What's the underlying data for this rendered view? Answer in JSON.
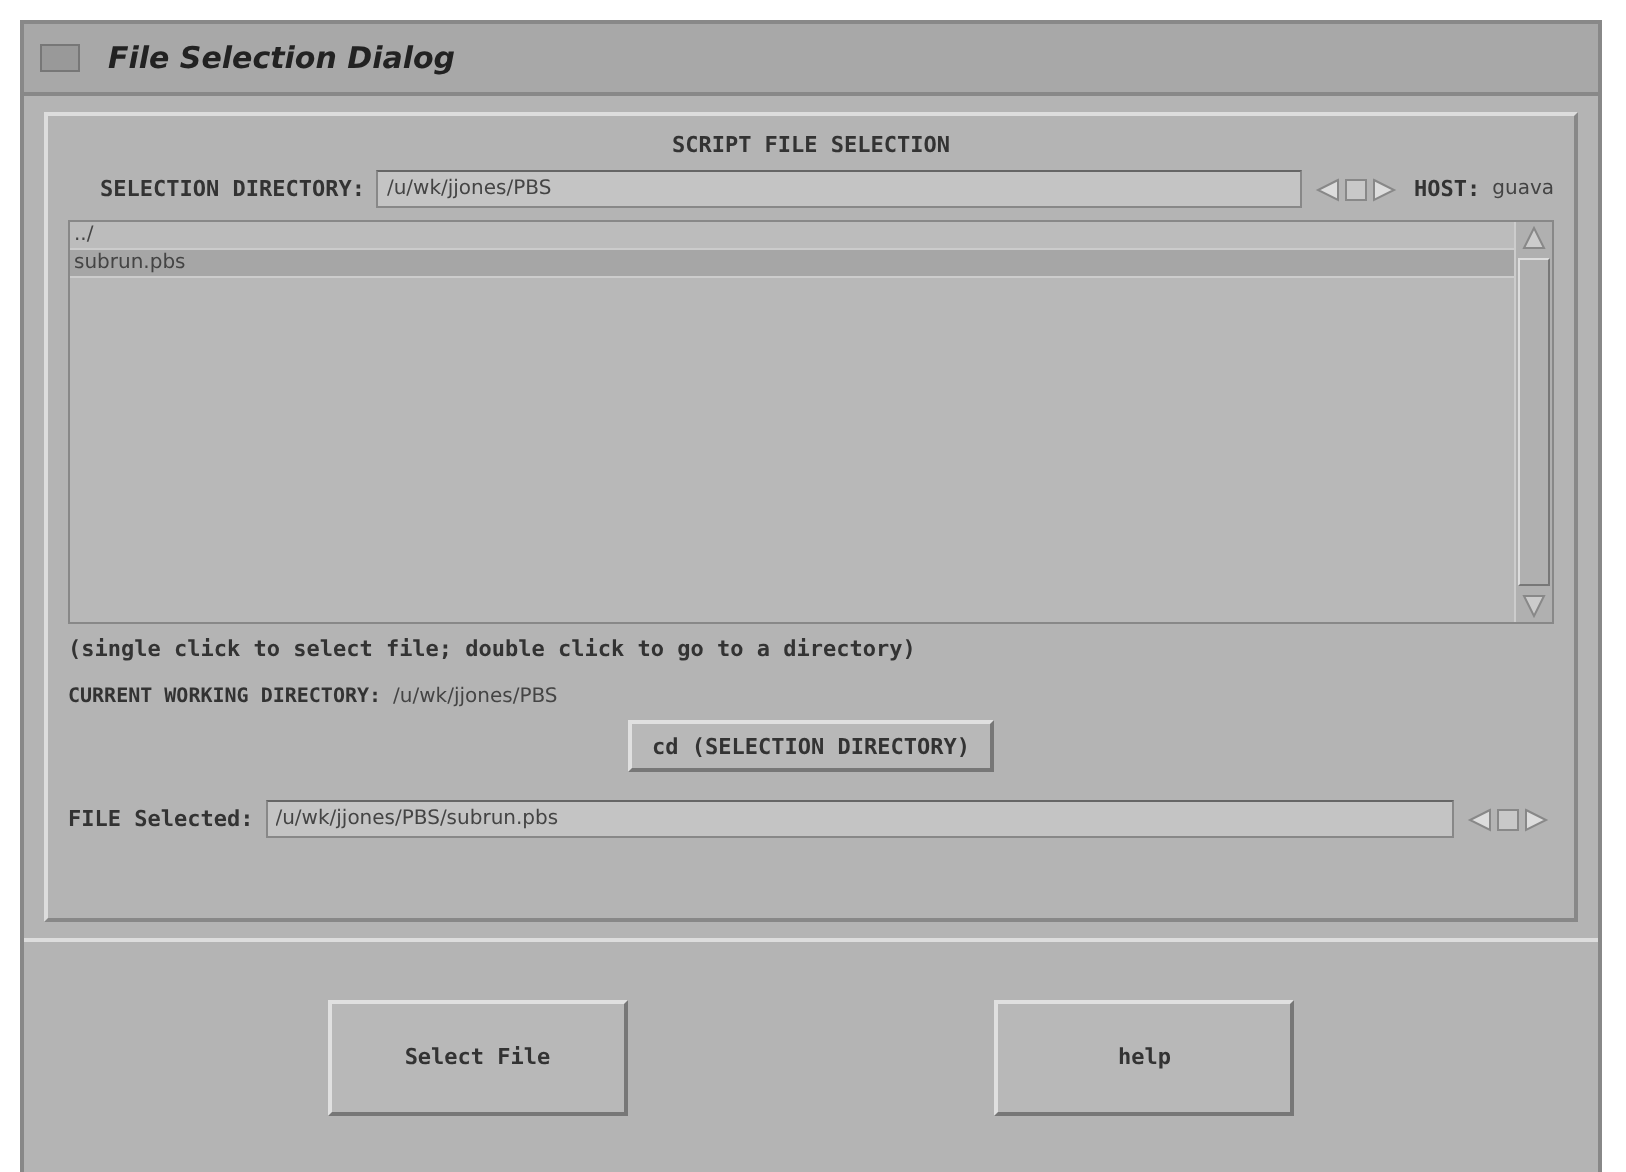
{
  "window": {
    "title": "File Selection Dialog"
  },
  "heading": "SCRIPT FILE SELECTION",
  "selection_directory": {
    "label": "SELECTION DIRECTORY:",
    "value": "/u/wk/jjones/PBS"
  },
  "host": {
    "label": "HOST:",
    "value": "guava"
  },
  "files": [
    {
      "name": "../",
      "selected": false
    },
    {
      "name": "subrun.pbs",
      "selected": true
    }
  ],
  "hint": "(single click to select file; double click to go to a directory)",
  "cwd": {
    "label": "CURRENT WORKING DIRECTORY:",
    "value": "/u/wk/jjones/PBS"
  },
  "cd_button": "cd (SELECTION DIRECTORY)",
  "file_selected": {
    "label": "FILE Selected:",
    "value": "/u/wk/jjones/PBS/subrun.pbs"
  },
  "buttons": [
    "Select File",
    "help"
  ]
}
